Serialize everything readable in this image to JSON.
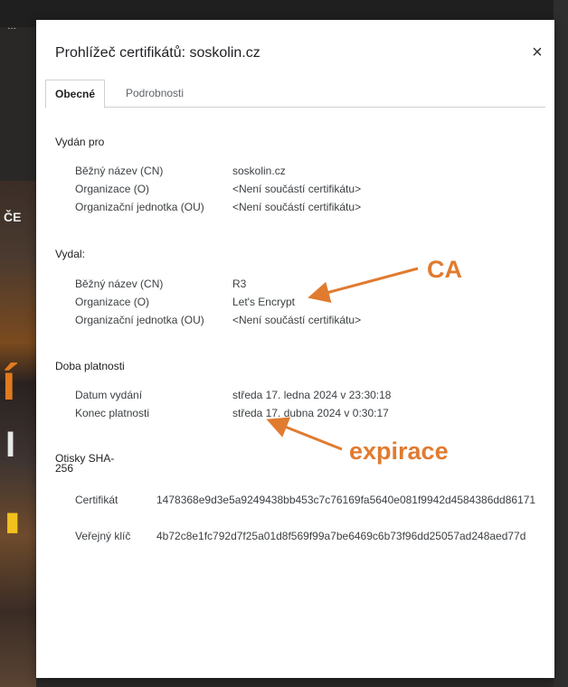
{
  "dialog": {
    "title": "Prohlížeč certifikátů: soskolin.cz",
    "close_icon": "×"
  },
  "tabs": [
    {
      "label": "Obecné",
      "active": true
    },
    {
      "label": "Podrobnosti",
      "active": false
    }
  ],
  "issued_to": {
    "heading": "Vydán pro",
    "rows": [
      {
        "label": "Běžný název (CN)",
        "value": "soskolin.cz"
      },
      {
        "label": "Organizace (O)",
        "value": "<Není součástí certifikátu>"
      },
      {
        "label": "Organizační jednotka (OU)",
        "value": "<Není součástí certifikátu>"
      }
    ]
  },
  "issued_by": {
    "heading": "Vydal:",
    "rows": [
      {
        "label": "Běžný název (CN)",
        "value": "R3"
      },
      {
        "label": "Organizace (O)",
        "value": "Let's Encrypt"
      },
      {
        "label": "Organizační jednotka (OU)",
        "value": "<Není součástí certifikátu>"
      }
    ]
  },
  "validity": {
    "heading": "Doba platnosti",
    "rows": [
      {
        "label": "Datum vydání",
        "value": "středa 17. ledna 2024 v 23:30:18"
      },
      {
        "label": "Konec platnosti",
        "value": "středa 17. dubna 2024 v 0:30:17"
      }
    ]
  },
  "fingerprints": {
    "heading": "Otisky SHA-256",
    "rows": [
      {
        "label": "Certifikát",
        "value": "1478368e9d3e5a9249438bb453c7c76169fa5640e081f9942d4584386dd86171"
      },
      {
        "label": "Veřejný klíč",
        "value": "4b72c8e1fc792d7f25a01d8f569f99a7be6469c6b73f96dd25057ad248aed77d"
      }
    ]
  },
  "annotations": {
    "ca": "CA",
    "expiration": "expirace",
    "color": "#e07b30"
  },
  "background": {
    "fragment_text": "ČE"
  }
}
